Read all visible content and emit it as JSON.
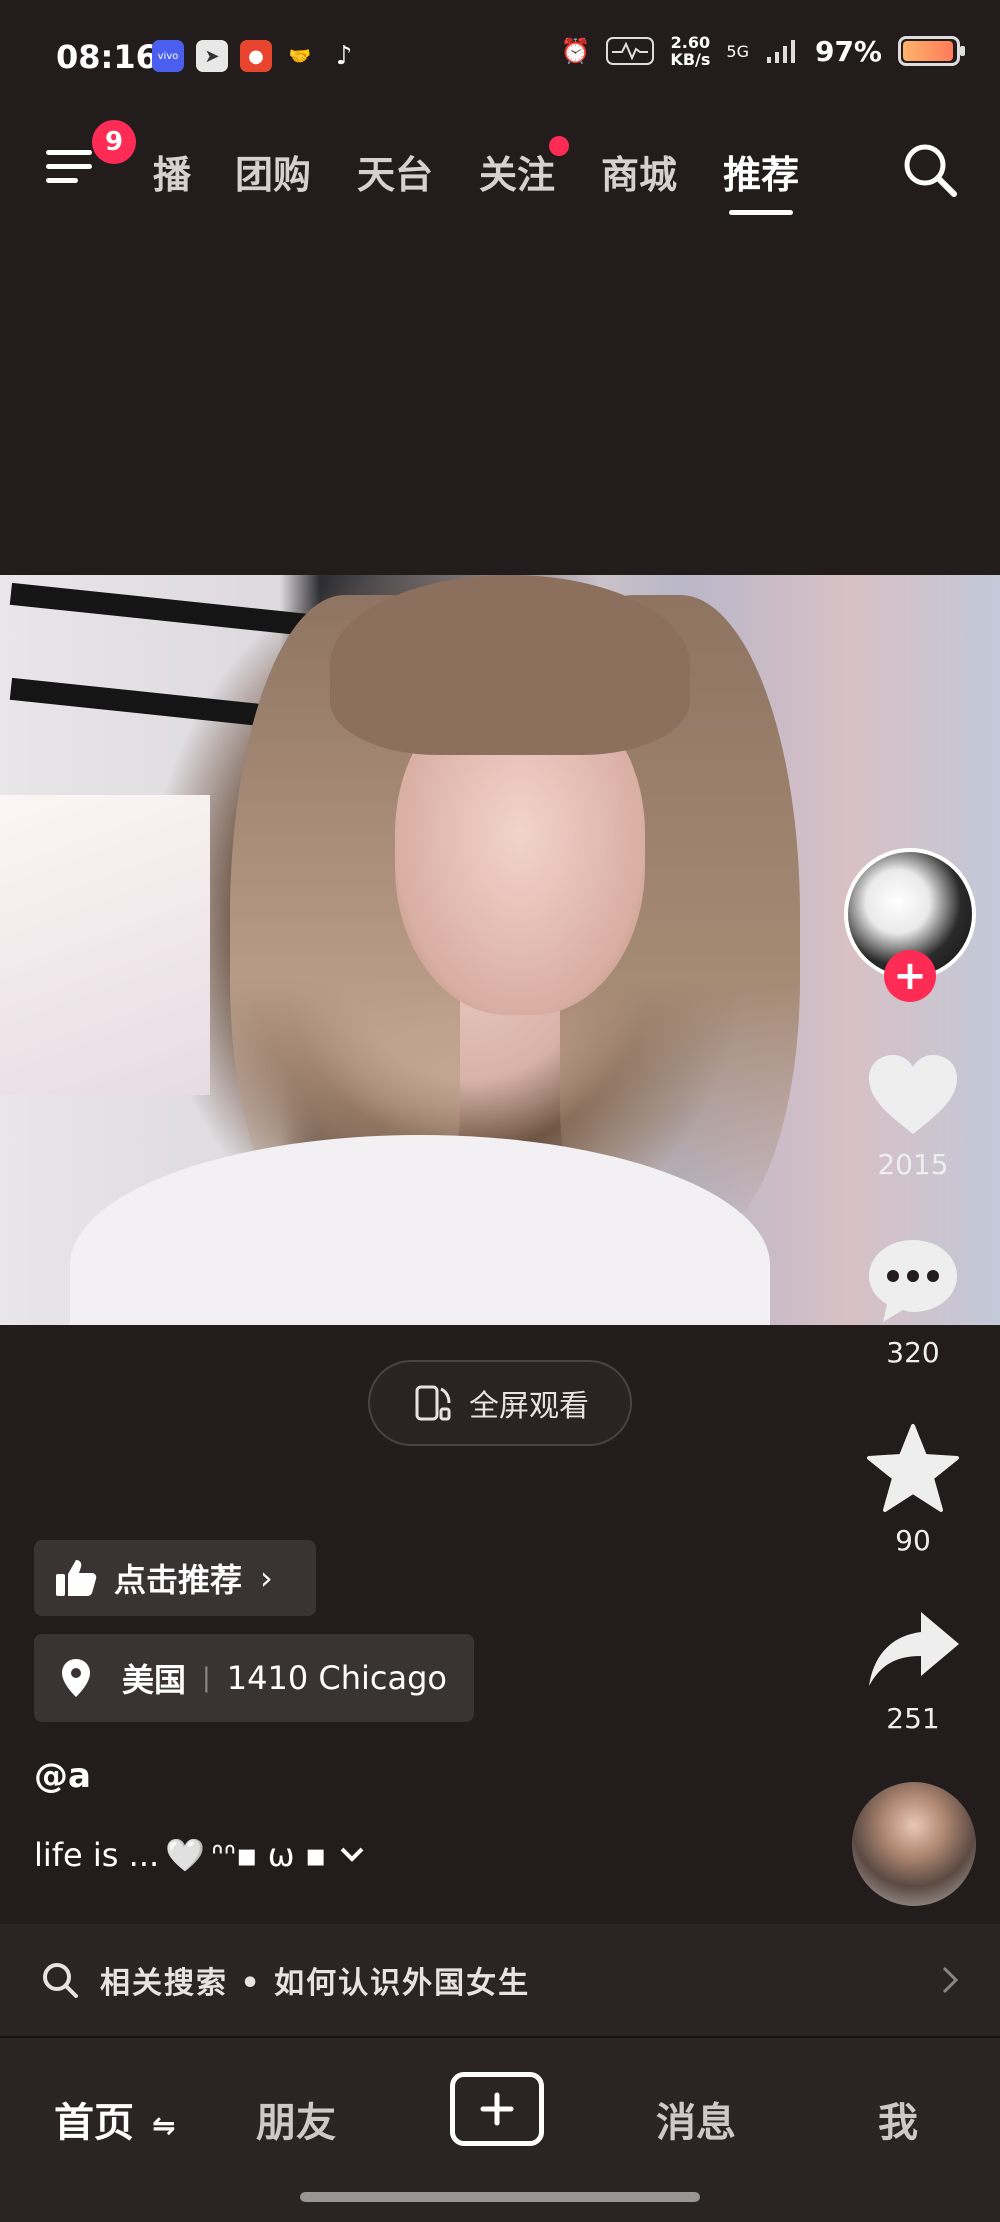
{
  "status_bar": {
    "time": "08:16",
    "net_speed_value": "2.60",
    "net_speed_unit": "KB/s",
    "network": "5G",
    "battery": "97%",
    "battery_level": 0.97,
    "app_icons": [
      "vivo-icon",
      "telegram-icon",
      "app-red-icon",
      "handshake-icon",
      "tiktok-icon"
    ]
  },
  "top_nav": {
    "menu_badge": "9",
    "tabs": [
      {
        "label": "直播",
        "shown": "播"
      },
      {
        "label": "团购"
      },
      {
        "label": "天台"
      },
      {
        "label": "关注",
        "has_dot": true
      },
      {
        "label": "商城"
      },
      {
        "label": "推荐",
        "active": true
      }
    ]
  },
  "video": {
    "fullscreen_label": "全屏观看"
  },
  "actions": {
    "likes": "2015",
    "comments": "320",
    "favorites": "90",
    "shares": "251"
  },
  "info": {
    "recommend_label": "点击推荐",
    "location_country": "美国",
    "location_detail": "1410 Chicago",
    "author": "@a",
    "caption_text": "life is ...",
    "caption_emoji": "🤍",
    "caption_kaomoji": "ᐢᐢ▪ ω ▪"
  },
  "related_search": {
    "label": "相关搜索",
    "separator": "•",
    "query": "如何认识外国女生"
  },
  "bottom_nav": {
    "home": "首页",
    "friends": "朋友",
    "messages": "消息",
    "me": "我"
  },
  "colors": {
    "background": "#231c1d",
    "accent_red": "#fe2c55",
    "panel": "#2b2425"
  }
}
